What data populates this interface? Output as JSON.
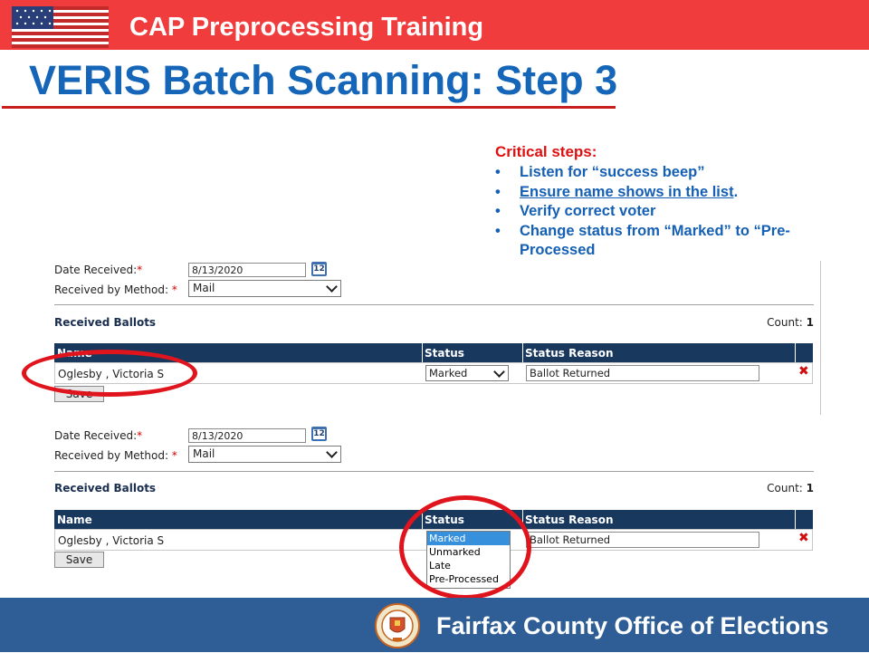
{
  "header": {
    "banner_title": "CAP Preprocessing Training",
    "slide_title": "VERIS Batch Scanning:  Step 3"
  },
  "critical": {
    "heading": "Critical steps:",
    "items": [
      {
        "text": "Listen for “success beep”"
      },
      {
        "text_underlined": "Ensure name shows in the list",
        "text_after": "."
      },
      {
        "text": "Verify correct voter"
      },
      {
        "text": "Change status from “Marked” to “Pre-Processed"
      }
    ],
    "bullet": "•"
  },
  "panel1": {
    "date_label": "Date Received:",
    "method_label": "Received by Method: ",
    "required_mark": "*",
    "date_value": "8/13/2020",
    "calendar_text": "12",
    "method_value": "Mail",
    "section_title": "Received Ballots",
    "count_label": "Count: ",
    "count_value": "1",
    "columns": {
      "name": "Name",
      "status": "Status",
      "reason": "Status Reason"
    },
    "row": {
      "name": "Oglesby , Victoria S",
      "status": "Marked",
      "reason": "Ballot Returned"
    },
    "save_label": "Save"
  },
  "panel2": {
    "date_label": "Date Received:",
    "method_label": "Received by Method: ",
    "required_mark": "*",
    "date_value": "8/13/2020",
    "calendar_text": "12",
    "method_value": "Mail",
    "section_title": "Received Ballots",
    "count_label": "Count: ",
    "count_value": "1",
    "columns": {
      "name": "Name",
      "status": "Status",
      "reason": "Status Reason"
    },
    "row": {
      "name": "Oglesby , Victoria S",
      "reason": "Ballot Returned"
    },
    "save_label": "Save",
    "dropdown_options": [
      "Marked",
      "Unmarked",
      "Late",
      "Pre-Processed"
    ],
    "dropdown_selected": "Marked"
  },
  "footer": {
    "org_name": "Fairfax County Office of Elections"
  },
  "colors": {
    "banner_red": "#f03c3c",
    "title_blue": "#1565b8",
    "critical_red": "#e01010",
    "table_header_navy": "#18385e",
    "footer_blue": "#2f5e96",
    "highlight_oval_red": "#e0141c"
  }
}
